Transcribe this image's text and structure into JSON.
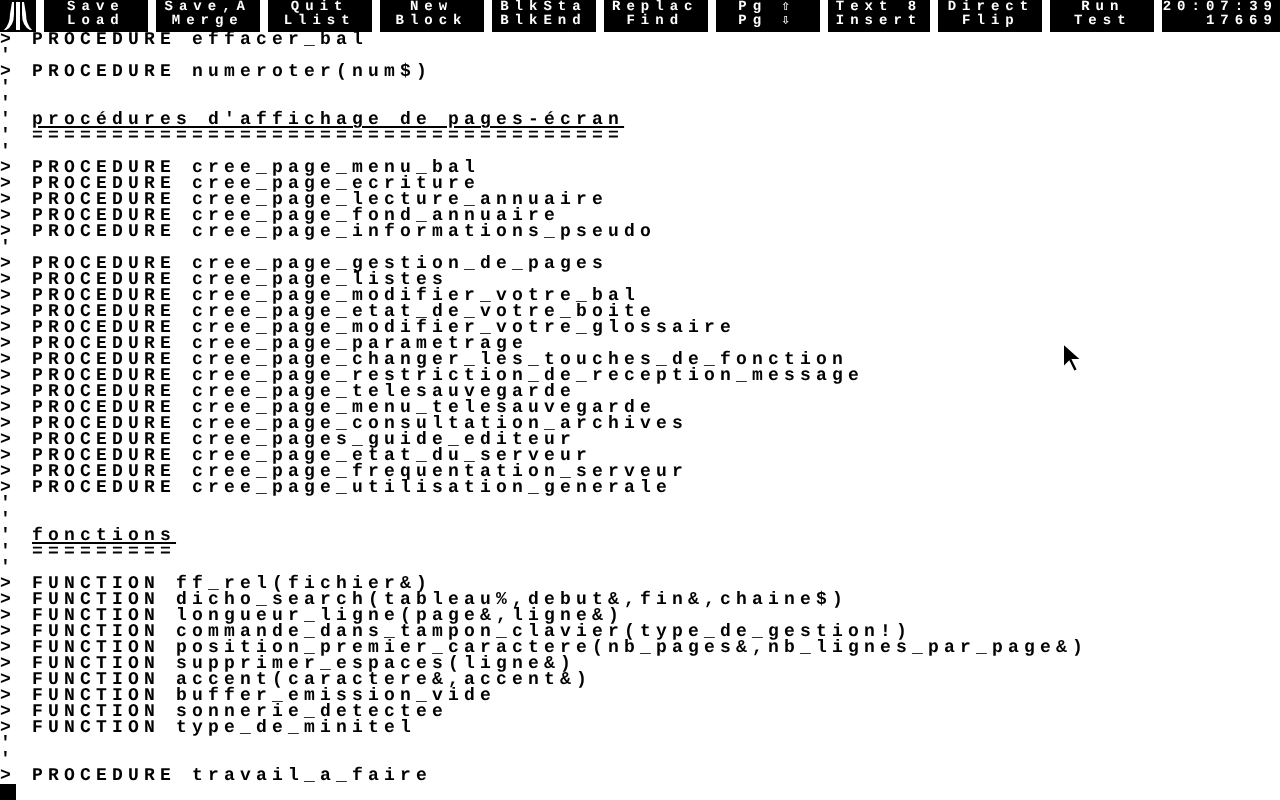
{
  "menu_buttons": [
    {
      "top": "Save",
      "bottom": "Load"
    },
    {
      "top": "Save,A",
      "bottom": "Merge"
    },
    {
      "top": "Quit",
      "bottom": "Llist"
    },
    {
      "top": "New",
      "bottom": "Block"
    },
    {
      "top": "BlkSta",
      "bottom": "BlkEnd"
    },
    {
      "top": "Replac",
      "bottom": "Find"
    },
    {
      "top": "Pg ⇧",
      "bottom": "Pg ⇩"
    },
    {
      "top": "Text 8",
      "bottom": "Insert"
    },
    {
      "top": "Direct",
      "bottom": "Flip"
    },
    {
      "top": "Run",
      "bottom": "Test"
    }
  ],
  "clock": {
    "time": "20:07:39",
    "counter": "17669"
  },
  "lines": [
    {
      "kind": "code",
      "marker": ">",
      "text": "PROCEDURE effacer_bal"
    },
    {
      "kind": "blank",
      "marker": "'"
    },
    {
      "kind": "code",
      "marker": ">",
      "text": "PROCEDURE numeroter(num$)"
    },
    {
      "kind": "blank",
      "marker": "'"
    },
    {
      "kind": "blank",
      "marker": "'"
    },
    {
      "kind": "heading",
      "marker": "'",
      "text": "procédures d'affichage de pages-écran"
    },
    {
      "kind": "rule",
      "marker": "'",
      "text": "====================================="
    },
    {
      "kind": "blank",
      "marker": "'"
    },
    {
      "kind": "code",
      "marker": ">",
      "text": "PROCEDURE cree_page_menu_bal"
    },
    {
      "kind": "code",
      "marker": ">",
      "text": "PROCEDURE cree_page_ecriture"
    },
    {
      "kind": "code",
      "marker": ">",
      "text": "PROCEDURE cree_page_lecture_annuaire"
    },
    {
      "kind": "code",
      "marker": ">",
      "text": "PROCEDURE cree_page_fond_annuaire"
    },
    {
      "kind": "code",
      "marker": ">",
      "text": "PROCEDURE cree_page_informations_pseudo"
    },
    {
      "kind": "blank",
      "marker": "'"
    },
    {
      "kind": "code",
      "marker": ">",
      "text": "PROCEDURE cree_page_gestion_de_pages"
    },
    {
      "kind": "code",
      "marker": ">",
      "text": "PROCEDURE cree_page_listes"
    },
    {
      "kind": "code",
      "marker": ">",
      "text": "PROCEDURE cree_page_modifier_votre_bal"
    },
    {
      "kind": "code",
      "marker": ">",
      "text": "PROCEDURE cree_page_etat_de_votre_boite"
    },
    {
      "kind": "code",
      "marker": ">",
      "text": "PROCEDURE cree_page_modifier_votre_glossaire"
    },
    {
      "kind": "code",
      "marker": ">",
      "text": "PROCEDURE cree_page_parametrage"
    },
    {
      "kind": "code",
      "marker": ">",
      "text": "PROCEDURE cree_page_changer_les_touches_de_fonction"
    },
    {
      "kind": "code",
      "marker": ">",
      "text": "PROCEDURE cree_page_restriction_de_reception_message"
    },
    {
      "kind": "code",
      "marker": ">",
      "text": "PROCEDURE cree_page_telesauvegarde"
    },
    {
      "kind": "code",
      "marker": ">",
      "text": "PROCEDURE cree_page_menu_telesauvegarde"
    },
    {
      "kind": "code",
      "marker": ">",
      "text": "PROCEDURE cree_page_consultation_archives"
    },
    {
      "kind": "code",
      "marker": ">",
      "text": "PROCEDURE cree_pages_guide_editeur"
    },
    {
      "kind": "code",
      "marker": ">",
      "text": "PROCEDURE cree_page_etat_du_serveur"
    },
    {
      "kind": "code",
      "marker": ">",
      "text": "PROCEDURE cree_page_frequentation_serveur"
    },
    {
      "kind": "code",
      "marker": ">",
      "text": "PROCEDURE cree_page_utilisation_generale"
    },
    {
      "kind": "blank",
      "marker": "'"
    },
    {
      "kind": "blank",
      "marker": "'"
    },
    {
      "kind": "heading",
      "marker": "'",
      "text": "fonctions"
    },
    {
      "kind": "rule",
      "marker": "'",
      "text": "========="
    },
    {
      "kind": "blank",
      "marker": "'"
    },
    {
      "kind": "code",
      "marker": ">",
      "text": "FUNCTION ff_rel(fichier&)"
    },
    {
      "kind": "code",
      "marker": ">",
      "text": "FUNCTION dicho_search(tableau%,debut&,fin&,chaine$)"
    },
    {
      "kind": "code",
      "marker": ">",
      "text": "FUNCTION longueur_ligne(page&,ligne&)"
    },
    {
      "kind": "code",
      "marker": ">",
      "text": "FUNCTION commande_dans_tampon_clavier(type_de_gestion!)"
    },
    {
      "kind": "code",
      "marker": ">",
      "text": "FUNCTION position_premier_caractere(nb_pages&,nb_lignes_par_page&)"
    },
    {
      "kind": "code",
      "marker": ">",
      "text": "FUNCTION supprimer_espaces(ligne&)"
    },
    {
      "kind": "code",
      "marker": ">",
      "text": "FUNCTION accent(caractere&,accent&)"
    },
    {
      "kind": "code",
      "marker": ">",
      "text": "FUNCTION buffer_emission_vide"
    },
    {
      "kind": "code",
      "marker": ">",
      "text": "FUNCTION sonnerie_detectee"
    },
    {
      "kind": "code",
      "marker": ">",
      "text": "FUNCTION type_de_minitel"
    },
    {
      "kind": "blank",
      "marker": "'"
    },
    {
      "kind": "blank",
      "marker": "'"
    },
    {
      "kind": "code",
      "marker": ">",
      "text": "PROCEDURE travail_a_faire"
    }
  ]
}
